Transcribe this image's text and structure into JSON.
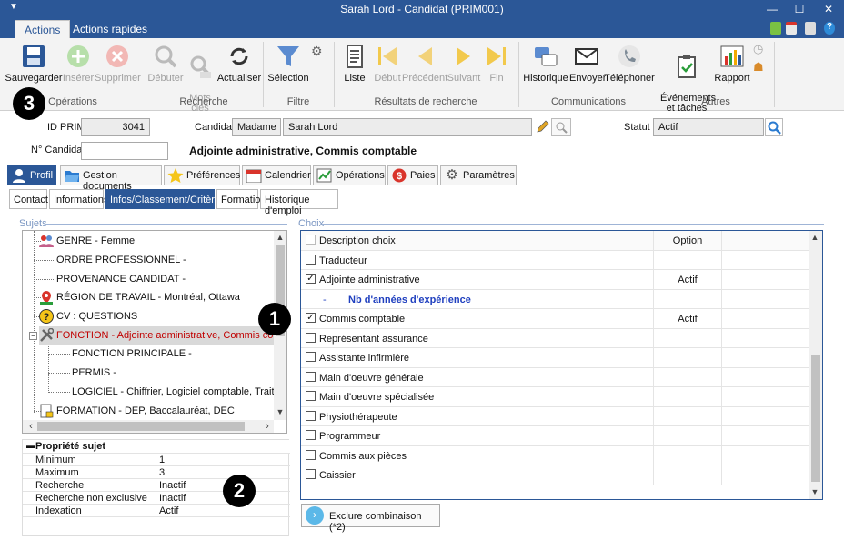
{
  "window": {
    "title": "Sarah Lord - Candidat (PRIM001)",
    "controls": [
      "—",
      "☐",
      "✕"
    ]
  },
  "ribbon_tabs": [
    "Actions",
    "Actions rapides"
  ],
  "ribbon": {
    "operations": {
      "label": "Opérations",
      "save": "Sauvegarder",
      "insert": "Insérer",
      "delete": "Supprimer"
    },
    "recherche": {
      "label": "Recherche",
      "start": "Débuter",
      "keywords": "Mots\nclés",
      "refresh": "Actualiser"
    },
    "filtre": {
      "label": "Filtre",
      "selection": "Sélection"
    },
    "resultats": {
      "label": "Résultats de recherche",
      "list": "Liste",
      "first": "Début",
      "prev": "Précédent",
      "next": "Suivant",
      "last": "Fin"
    },
    "communications": {
      "label": "Communications",
      "history": "Historique",
      "send": "Envoyer",
      "phone": "Téléphoner"
    },
    "autres": {
      "label": "Autres",
      "events": "Événements\net tâches",
      "report": "Rapport"
    }
  },
  "header": {
    "id_label": "ID PRIM",
    "id_value": "3041",
    "candidate_label": "Candidat",
    "salutation": "Madame",
    "name": "Sarah Lord",
    "status_label": "Statut",
    "status_value": "Actif",
    "num_label": "N° Candidat",
    "num_value": "",
    "job_title": "Adjointe administrative, Commis comptable"
  },
  "main_tabs": [
    "Profil",
    "Gestion documents",
    "Préférences",
    "Calendrier",
    "Opérations",
    "Paies",
    "Paramètres"
  ],
  "sub_tabs": [
    "Contact",
    "Informations",
    "Infos/Classement/Critères",
    "Formation",
    "Historique d'emploi"
  ],
  "sujets": {
    "title": "Sujets",
    "nodes": [
      "GENRE - Femme",
      "ORDRE PROFESSIONNEL -",
      "PROVENANCE CANDIDAT -",
      "RÉGION DE TRAVAIL - Montréal, Ottawa",
      "CV : QUESTIONS",
      "FONCTION - Adjointe administrative, Commis comptable",
      "FONCTION PRINCIPALE -",
      "PERMIS -",
      "LOGICIEL - Chiffrier, Logiciel comptable, Traitement de",
      "FORMATION - DEP, Baccalauréat, DEC"
    ]
  },
  "properties": {
    "title": "Propriété sujet",
    "rows": [
      {
        "key": "Minimum",
        "value": "1"
      },
      {
        "key": "Maximum",
        "value": "3"
      },
      {
        "key": "Recherche",
        "value": "Inactif"
      },
      {
        "key": "Recherche non exclusive",
        "value": "Inactif"
      },
      {
        "key": "Indexation",
        "value": "Actif"
      }
    ]
  },
  "choix": {
    "title": "Choix",
    "header": {
      "label": "Description choix",
      "option": "Option"
    },
    "rows": [
      {
        "label": "Traducteur",
        "checked": false,
        "option": ""
      },
      {
        "label": "Adjointe administrative",
        "checked": true,
        "option": "Actif"
      },
      {
        "label": "Nb d'années d'expérience",
        "checked": null,
        "option": ""
      },
      {
        "label": "Commis comptable",
        "checked": true,
        "option": "Actif"
      },
      {
        "label": "Représentant assurance",
        "checked": false,
        "option": ""
      },
      {
        "label": "Assistante infirmière",
        "checked": false,
        "option": ""
      },
      {
        "label": "Main d'oeuvre générale",
        "checked": false,
        "option": ""
      },
      {
        "label": "Main d'oeuvre spécialisée",
        "checked": false,
        "option": ""
      },
      {
        "label": "Physiothérapeute",
        "checked": false,
        "option": ""
      },
      {
        "label": "Programmeur",
        "checked": false,
        "option": ""
      },
      {
        "label": "Commis aux pièces",
        "checked": false,
        "option": ""
      },
      {
        "label": "Caissier",
        "checked": false,
        "option": ""
      }
    ],
    "sub_dash": "-"
  },
  "exclude_button": "Exclure combinaison (*2)",
  "callouts": [
    "1",
    "2",
    "3"
  ],
  "colors": {
    "accent": "#2b5797",
    "selected_text": "#c00000",
    "sub_item": "#1f3fbf"
  }
}
